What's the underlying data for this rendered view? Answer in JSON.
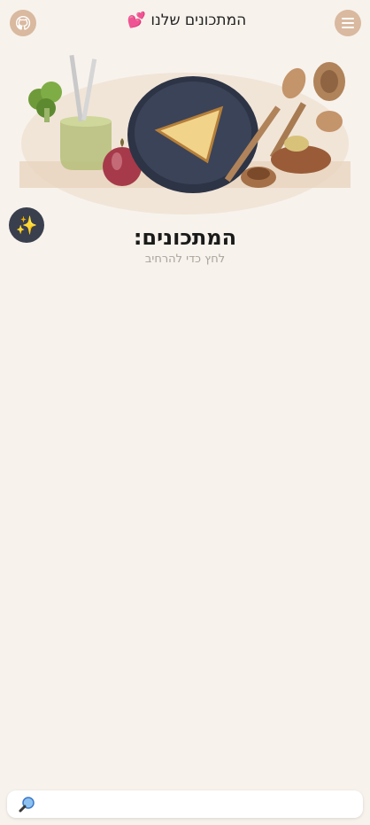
{
  "header": {
    "title": "המתכונים שלנו",
    "heart_glyph": "💕",
    "github_icon": "github-icon",
    "menu_icon": "hamburger-menu-icon"
  },
  "hero": {
    "image": "illustration of cooking: plate with cheese triangle, broccoli, onion, wooden spoons"
  },
  "magic_button": {
    "glyph": "✨"
  },
  "main": {
    "heading": "המתכונים:",
    "subheading": "לחץ כדי להרחיב"
  },
  "search": {
    "placeholder": "",
    "value": "",
    "icon": "search-icon"
  },
  "colors": {
    "background": "#f7f2ec",
    "accent_circle": "#d9b99f",
    "dark_button": "#3a3f4e"
  }
}
